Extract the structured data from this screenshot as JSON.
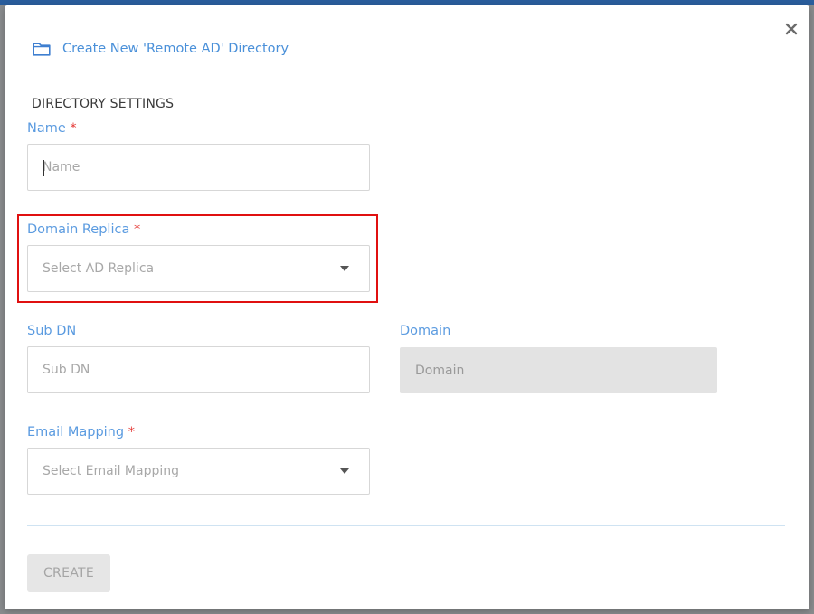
{
  "dialog": {
    "title": "Create New 'Remote AD' Directory",
    "icon": "folder-icon",
    "close_icon": "close-icon",
    "section_title": "DIRECTORY SETTINGS"
  },
  "form": {
    "name": {
      "label": "Name",
      "required_mark": "*",
      "value": "",
      "placeholder": "Name"
    },
    "domain_replica": {
      "label": "Domain Replica",
      "required_mark": "*",
      "selected": "Select AD Replica"
    },
    "sub_dn": {
      "label": "Sub DN",
      "value": "",
      "placeholder": "Sub DN"
    },
    "domain": {
      "label": "Domain",
      "value": "",
      "placeholder": "Domain",
      "disabled": true
    },
    "email_mapping": {
      "label": "Email Mapping",
      "required_mark": "*",
      "selected": "Select Email Mapping"
    }
  },
  "actions": {
    "create_label": "CREATE"
  },
  "colors": {
    "accent": "#4a90d9",
    "label": "#5b9be0",
    "required": "#e53935",
    "highlight": "#e01010"
  }
}
